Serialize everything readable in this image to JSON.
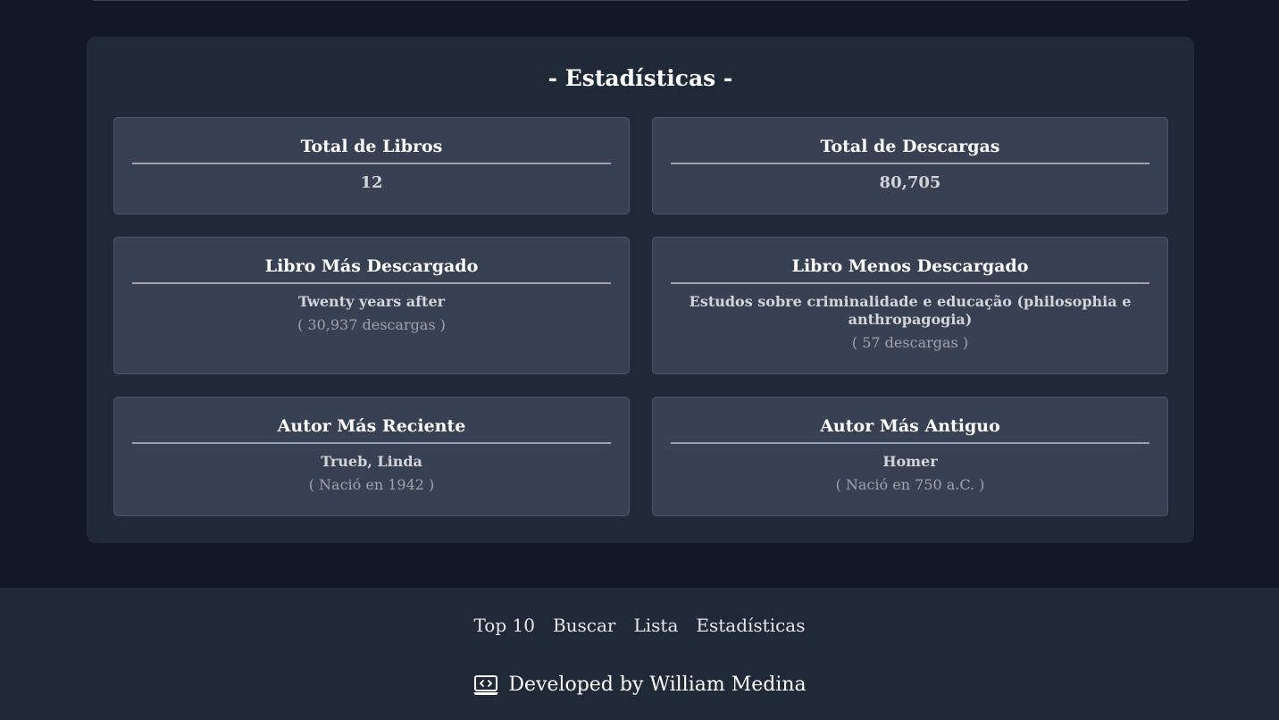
{
  "stats": {
    "title": "- Estadísticas -",
    "total_books": {
      "label": "Total de Libros",
      "value": "12"
    },
    "total_downloads": {
      "label": "Total de Descargas",
      "value": "80,705"
    },
    "most_downloaded": {
      "label": "Libro Más Descargado",
      "book": "Twenty years after",
      "detail": "( 30,937 descargas )"
    },
    "least_downloaded": {
      "label": "Libro Menos Descargado",
      "book": "Estudos sobre criminalidade e educação (philosophia e anthropagogia)",
      "detail": "( 57 descargas )"
    },
    "most_recent_author": {
      "label": "Autor Más Reciente",
      "name": "Trueb, Linda",
      "detail": "( Nació en 1942 )"
    },
    "oldest_author": {
      "label": "Autor Más Antiguo",
      "name": "Homer",
      "detail": "( Nació en 750 a.C. )"
    }
  },
  "footer": {
    "nav": [
      "Top 10",
      "Buscar",
      "Lista",
      "Estadísticas"
    ],
    "credit": "Developed by William Medina",
    "credit_icon": "laptop-code-icon"
  }
}
